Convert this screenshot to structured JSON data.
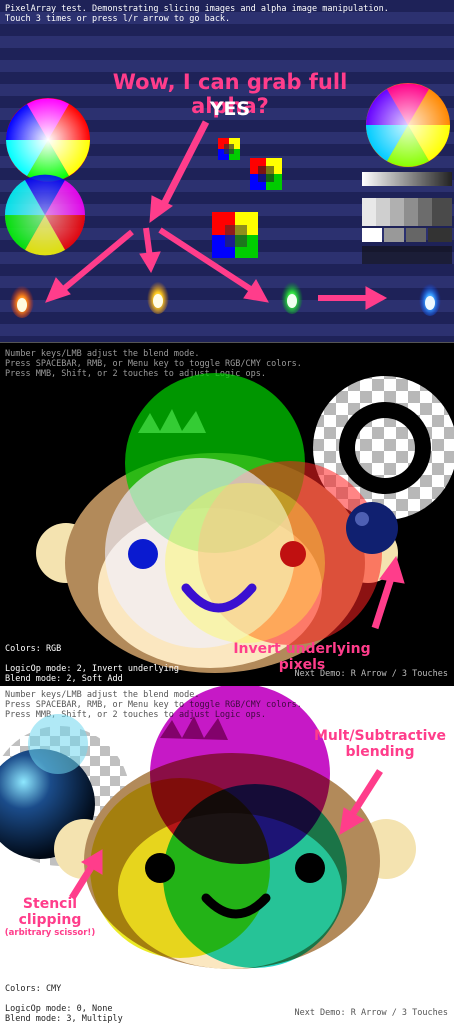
{
  "panel1": {
    "info_line1": "PixelArray test. Demonstrating slicing images and alpha image manipulation.",
    "info_line2": "Touch 3 times or press l/r arrow to go back.",
    "callout_title": "Wow, I can grab full alpha?",
    "callout_answer": "YES"
  },
  "panel2": {
    "info_line1": "Number keys/LMB adjust the blend mode.",
    "info_line2": "Press SPACEBAR, RMB, or Menu key to toggle RGB/CMY colors.",
    "info_line3": "Press MMB, Shift, or 2 touches to adjust Logic ops.",
    "colors": "Colors: RGB",
    "logicop": "LogicOp mode: 2, Invert underlying",
    "blend": "Blend mode: 2, Soft Add",
    "next_demo": "Next Demo: R Arrow / 3 Touches",
    "callout": "Invert underlying pixels"
  },
  "panel3": {
    "info_line1": "Number keys/LMB adjust the blend mode.",
    "info_line2": "Press SPACEBAR, RMB, or Menu key to toggle RGB/CMY colors.",
    "info_line3": "Press MMB, Shift, or 2 touches to adjust Logic ops.",
    "colors": "Colors: CMY",
    "logicop": "LogicOp mode: 0, None",
    "blend": "Blend mode: 3, Multiply",
    "next_demo": "Next Demo: R Arrow / 3 Touches",
    "callout_blend_1": "Mult/Subtractive",
    "callout_blend_2": "blending",
    "callout_stencil_1": "Stencil",
    "callout_stencil_2": "clipping",
    "callout_stencil_3": "(arbitrary scissor!)"
  },
  "colors": {
    "accent_pink": "#ff3d8b",
    "stripe_dark": "#1e2258",
    "stripe_light": "#2c3170"
  }
}
